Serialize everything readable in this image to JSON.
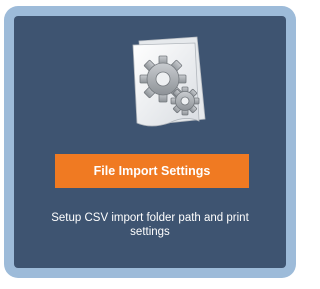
{
  "card": {
    "icon": "settings-document-icon",
    "button_label": "File Import Settings",
    "description": "Setup CSV import folder path and print settings"
  },
  "colors": {
    "frame": "#9dbbd9",
    "card_background": "#3e5471",
    "button_accent": "#f07a22",
    "text": "#ffffff"
  }
}
